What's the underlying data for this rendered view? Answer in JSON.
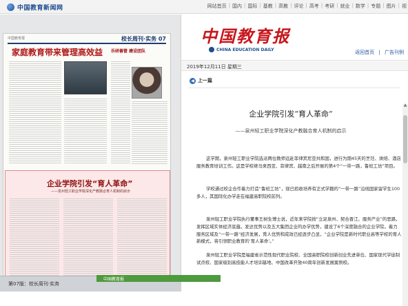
{
  "site": {
    "logo_text": "中国教育新闻网"
  },
  "top_nav": [
    "网站首页",
    "国内",
    "国际",
    "基教",
    "高教",
    "评论",
    "高考",
    "考研",
    "就业",
    "数学",
    "专题",
    "图片",
    "视"
  ],
  "paper": {
    "masthead": "中国教育报",
    "section": "校长周刊·实务 07",
    "headline": "家庭教育带来管理高效益",
    "sub_title": "乐研善管 建设团队",
    "sub_title2": "",
    "highlight_title": "企业学院引发“育人革命”",
    "highlight_sub": "——泉州轻工职业学院深化产教融合育人机制的启示",
    "bottom_tab": "第07版：校长周刊·实务"
  },
  "brand": {
    "logo": "中国教育报",
    "sub": "CHINA EDUCATION DAILY"
  },
  "links": [
    "返回首页",
    "广告刊例"
  ],
  "date": "2019年12月11日  星期三",
  "prev_label": "上一篇",
  "article": {
    "title": "企业学院引发“育人革命”",
    "subtitle": "——泉州轻工职业学院深化产教融合育人机制的启示",
    "paragraphs": [
      "这学期，泉州轻工职业学院选派两位教师远赴菲律宾尼亚共和国，进行为期45天的烹饪、烘焙、酒店服务教育培训工作。这是学校继马来西亚、菲律宾、越南之后开展的第4个“一带一路，鲁班工坊”项目。",
      "学校通过校企合作着力打造“鲁班工坊”，现已招收培养有正式学籍的“一带一路”沿线国家留学生100多人，其国际化办学走在福建高职院校前列。",
      "泉州轻工职业学院执行董事王树生博士说，近年来学院按“立足泉州、契合晋江、服务产业”的思路，发挥区域实体经济底蕴，发达优势以及五大集团企业的办学优势，建设了6个深度融合的企业学院，着力服务区域及“一带一路”经济发展，育人优势和成效已经逐步凸显，“企业学院是新时代职业高等学校的育人新模式，将引领职业教育的‘育人革命’。”",
      "泉州轻工职业学院是福建省示范性现代职业院校、全国高职院校创新创业先进单位、国家现代学徒制试点校、国家级别高技能人才培训基地、中国改革开放40周年创新发展案例校。"
    ]
  },
  "green_bar_label": "中国教育报",
  "colors": {
    "brand_red": "#c8161d",
    "link_blue": "#2a5aa5",
    "highlight_pink": "#fce8e8"
  }
}
